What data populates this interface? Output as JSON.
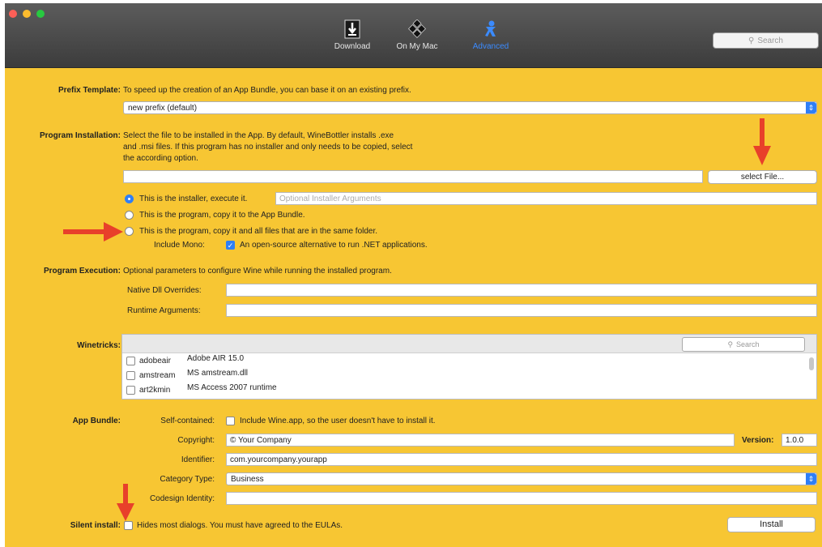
{
  "toolbar": {
    "download": "Download",
    "on_my_mac": "On My Mac",
    "advanced": "Advanced",
    "search_placeholder": "Search"
  },
  "prefix": {
    "label": "Prefix Template:",
    "desc": "To speed up the creation of an App Bundle, you can base it on an existing prefix.",
    "selected": "new prefix (default)"
  },
  "install": {
    "label": "Program Installation:",
    "desc1": "Select the file to be installed in the App. By default, WineBottler installs .exe",
    "desc2": "and .msi files. If this program has no installer and only needs to be copied, select",
    "desc3": "the according option.",
    "file_value": "",
    "select_file": "select File...",
    "opt1": "This is the installer, execute it.",
    "args_placeholder": "Optional Installer Arguments",
    "opt2": "This is the program, copy it to the App Bundle.",
    "opt3": "This is the program, copy it and all files that are in the same folder.",
    "mono_label": "Include Mono:",
    "mono_desc": "An open-source alternative to run .NET applications."
  },
  "execution": {
    "label": "Program Execution:",
    "desc": "Optional parameters to configure Wine while running the installed program.",
    "dll_label": "Native Dll Overrides:",
    "runtime_label": "Runtime Arguments:"
  },
  "winetricks": {
    "label": "Winetricks:",
    "search_placeholder": "Search",
    "items": [
      {
        "key": "adobeair",
        "value": "Adobe AIR 15.0"
      },
      {
        "key": "amstream",
        "value": "MS amstream.dll"
      },
      {
        "key": "art2kmin",
        "value": "MS Access 2007 runtime"
      }
    ]
  },
  "bundle": {
    "label": "App Bundle:",
    "self_label": "Self-contained:",
    "self_desc": "Include Wine.app, so the user doesn't have to install it.",
    "copyright_label": "Copyright:",
    "copyright_value": "© Your Company",
    "version_label": "Version:",
    "version_value": "1.0.0",
    "identifier_label": "Identifier:",
    "identifier_value": "com.yourcompany.yourapp",
    "category_label": "Category Type:",
    "category_value": "Business",
    "codesign_label": "Codesign Identity:",
    "codesign_value": ""
  },
  "silent": {
    "label": "Silent install:",
    "desc": "Hides most dialogs. You must have agreed to the EULAs."
  },
  "install_button": "Install",
  "colors": {
    "background": "#f7c633",
    "accent": "#2f7ff6",
    "arrow": "#e8402a"
  }
}
